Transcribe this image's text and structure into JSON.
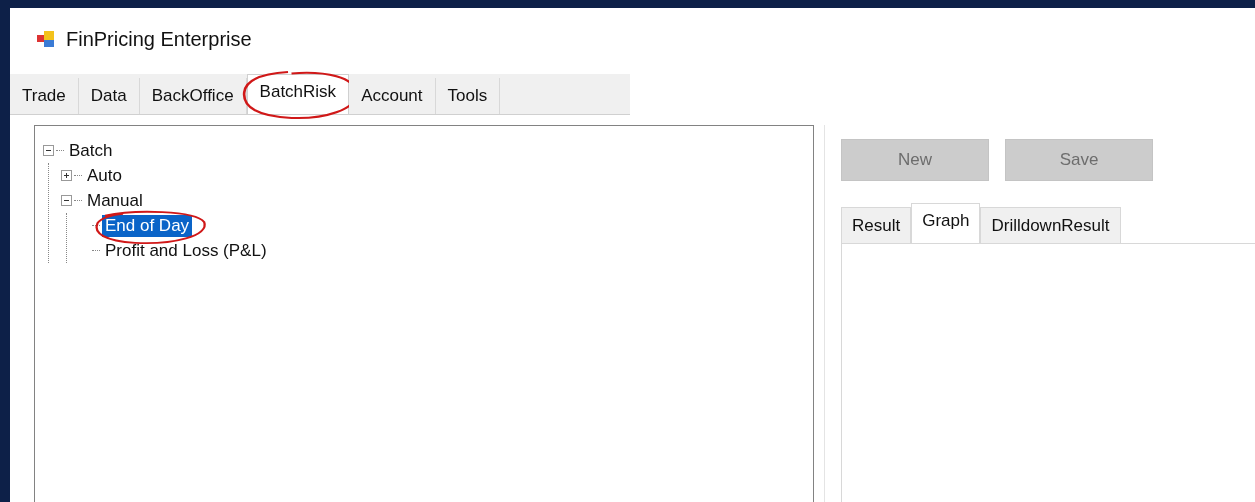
{
  "window": {
    "title": "FinPricing Enterprise"
  },
  "tabs": [
    {
      "label": "Trade",
      "selected": false,
      "circled": false
    },
    {
      "label": "Data",
      "selected": false,
      "circled": false
    },
    {
      "label": "BackOffice",
      "selected": false,
      "circled": false
    },
    {
      "label": "BatchRisk",
      "selected": true,
      "circled": true
    },
    {
      "label": "Account",
      "selected": false,
      "circled": false
    },
    {
      "label": "Tools",
      "selected": false,
      "circled": false
    }
  ],
  "tree": [
    {
      "label": "Batch",
      "expanded": true,
      "selected": false,
      "circled": false,
      "children": [
        {
          "label": "Auto",
          "expanded": false,
          "selected": false,
          "circled": false
        },
        {
          "label": "Manual",
          "expanded": true,
          "selected": false,
          "circled": false,
          "children": [
            {
              "label": "End of Day",
              "selected": true,
              "circled": true
            },
            {
              "label": "Profit and Loss (P&L)",
              "selected": false,
              "circled": false
            }
          ]
        }
      ]
    }
  ],
  "buttons": [
    {
      "label": "New",
      "disabled": true
    },
    {
      "label": "Save",
      "disabled": true
    }
  ],
  "result_tabs": [
    {
      "label": "Result",
      "selected": false
    },
    {
      "label": "Graph",
      "selected": true
    },
    {
      "label": "DrilldownResult",
      "selected": false
    }
  ]
}
